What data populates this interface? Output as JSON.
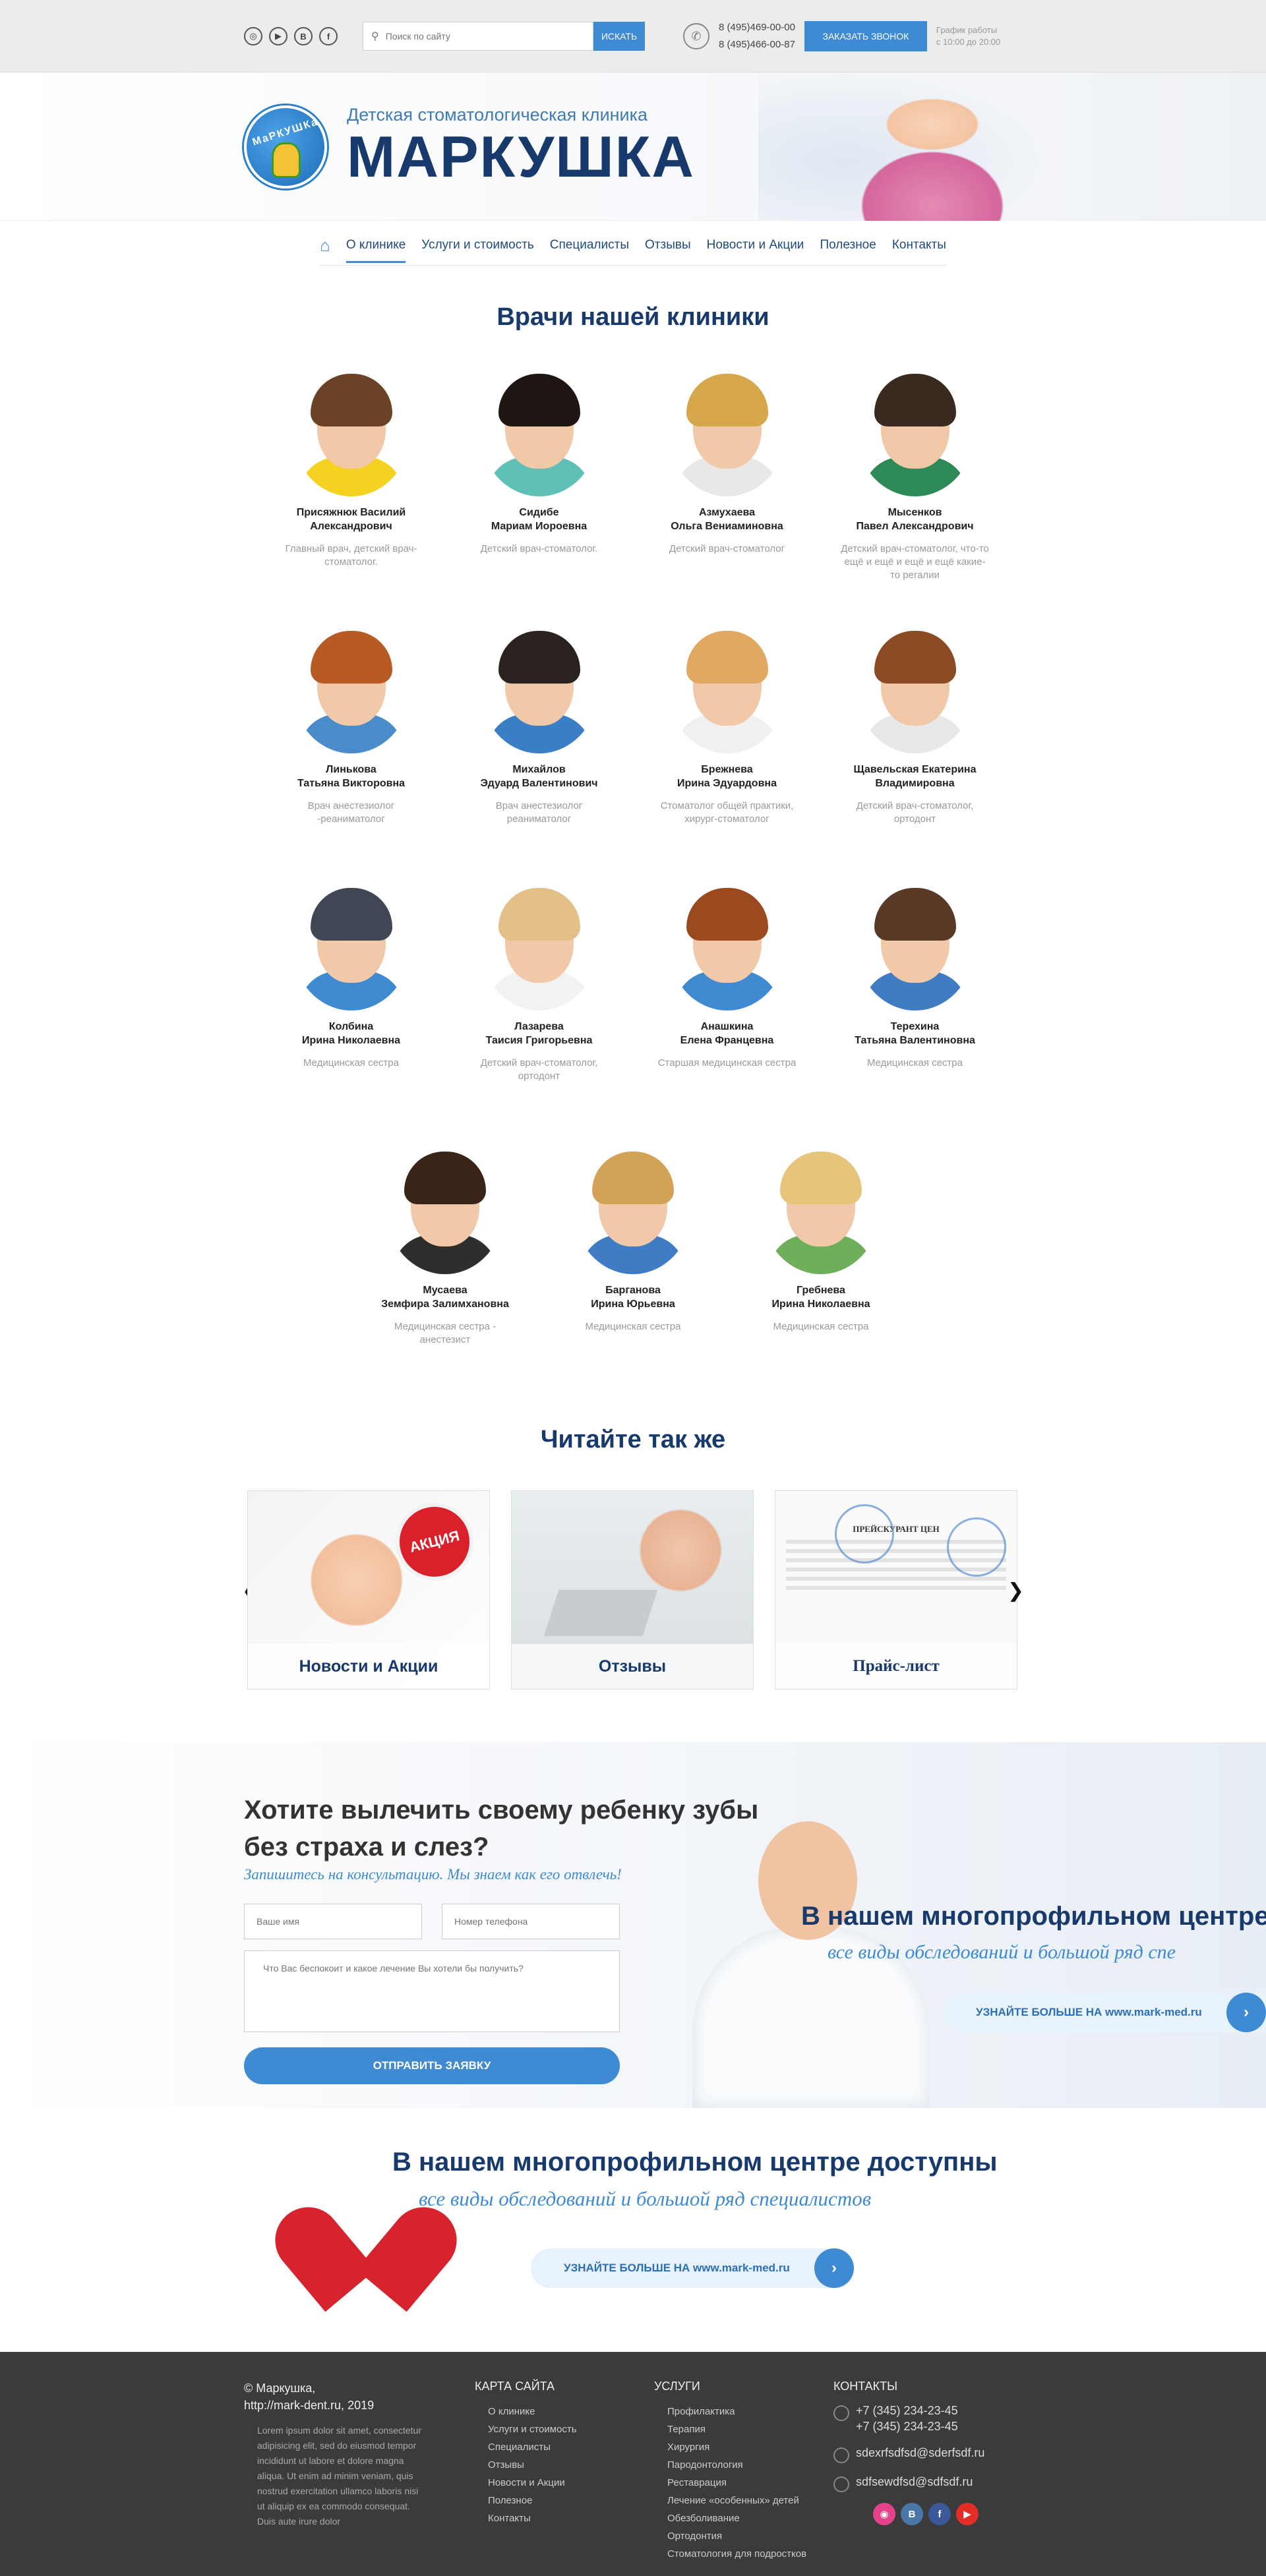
{
  "topbar": {
    "social": [
      {
        "icon": "globe-icon",
        "glyph": "◎"
      },
      {
        "icon": "youtube-icon",
        "glyph": "▶"
      },
      {
        "icon": "vk-icon",
        "glyph": "B"
      },
      {
        "icon": "facebook-icon",
        "glyph": "f"
      }
    ],
    "search_placeholder": "Поиск по сайту",
    "search_button": "ИСКАТЬ",
    "phone1": "8 (495)469-00-00",
    "phone2": "8 (495)466-00-87",
    "call_button": "ЗАКАЗАТЬ ЗВОНОК",
    "hours_line1": "График работы",
    "hours_line2": "с 10:00 до 20:00"
  },
  "header": {
    "logo_letters": "МаРКУШКа",
    "subtitle": "Детская стоматологическая клиника",
    "name": "МАРКУШКА"
  },
  "nav": {
    "items": [
      "О клинике",
      "Услуги и стоимость",
      "Специалисты",
      "Отзывы",
      "Новости и Акции",
      "Полезное",
      "Контакты"
    ],
    "active": "О клинике"
  },
  "doctors": {
    "title": "Врачи нашей клиники",
    "list": [
      {
        "name1": "Присяжнюк Василий",
        "name2": "Александрович",
        "role": "Главный врач, детский врач-стоматолог.",
        "hair": "#6b4225",
        "shirt": "#f4d21f"
      },
      {
        "name1": "Сидибе",
        "name2": "Мариам Иороевна",
        "role": "Детский врач-стоматолог.",
        "hair": "#1d1612",
        "shirt": "#5fc0b8"
      },
      {
        "name1": "Азмухаева",
        "name2": "Ольга Вениаминовна",
        "role": "Детский врач-стоматолог",
        "hair": "#d6a64a",
        "shirt": "#e8e8e8"
      },
      {
        "name1": "Мысенков",
        "name2": "Павел Александрович",
        "role": "Детский врач-стоматолог, что-то ещё и ещё и ещё и ещё какие-то регалии",
        "hair": "#3a2a20",
        "shirt": "#2d8a56"
      },
      {
        "name1": "Линькова",
        "name2": "Татьяна Викторовна",
        "role": "Врач анестезиолог -реаниматолог",
        "hair": "#b85a24",
        "shirt": "#4a8cc9"
      },
      {
        "name1": "Михайлов",
        "name2": "Эдуард Валентинович",
        "role": "Врач анестезиолог реаниматолог",
        "hair": "#2a221e",
        "shirt": "#3a7fc6"
      },
      {
        "name1": "Брежнева",
        "name2": "Ирина Эдуардовна",
        "role": "Стоматолог общей практики, хирург-стоматолог",
        "hair": "#e0a861",
        "shirt": "#f0f0f0"
      },
      {
        "name1": "Щавельская Екатерина",
        "name2": "Владимировна",
        "role": "Детский врач-стоматолог, ортодонт",
        "hair": "#8a4a22",
        "shirt": "#e8e8e8"
      },
      {
        "name1": "Колбина",
        "name2": "Ирина Николаевна",
        "role": "Медицинская сестра",
        "hair": "#404654",
        "shirt": "#3f8ad0"
      },
      {
        "name1": "Лазарева",
        "name2": "Таисия Григорьевна",
        "role": "Детский врач-стоматолог, ортодонт",
        "hair": "#e4c089",
        "shirt": "#f2f2f2"
      },
      {
        "name1": "Анашкина",
        "name2": "Елена Францевна",
        "role": "Старшая медицинская сестра",
        "hair": "#9a4a1e",
        "shirt": "#3f8ad0"
      },
      {
        "name1": "Терехина",
        "name2": "Татьяна Валентиновна",
        "role": "Медицинская сестра",
        "hair": "#5a3a26",
        "shirt": "#3f7cc4"
      }
    ],
    "row3": [
      {
        "name1": "Мусаева",
        "name2": "Земфира Залимхановна",
        "role": "Медицинская сестра - анестезист",
        "hair": "#3a2418",
        "shirt": "#2e2e2e"
      },
      {
        "name1": "Барганова",
        "name2": "Ирина Юрьевна",
        "role": "Медицинская сестра",
        "hair": "#d2a357",
        "shirt": "#3f7cc4"
      },
      {
        "name1": "Гребнева",
        "name2": "Ирина Николаевна",
        "role": "Медицинская сестра",
        "hair": "#e6c47a",
        "shirt": "#6fae5a"
      }
    ]
  },
  "read_also": {
    "title": "Читайте так же",
    "cards": [
      "Новости и Акции",
      "Отзывы",
      "Прайс-лист"
    ],
    "badge": "АКЦИЯ",
    "price_doc_title": "ПРЕЙСКУРАНТ ЦЕН"
  },
  "consult": {
    "title_line1": "Хотите вылечить своему ребенку зубы",
    "title_line2": "без страха и слез?",
    "subtitle": "Запишитесь на консультацию. Мы знаем как его отвлечь!",
    "name_placeholder": "Ваше имя",
    "phone_placeholder": "Номер телефона",
    "message_placeholder": "Что Вас беспокоит и какое лечение Вы хотели бы получить?",
    "submit": "ОТПРАВИТЬ ЗАЯВКУ",
    "promo_title": "В нашем многопрофильном центре",
    "promo_sub": "все виды обследований и большой ряд спе",
    "promo_button": "УЗНАЙТЕ БОЛЬШЕ НА www.mark-med.ru"
  },
  "center_block": {
    "title": "В нашем многопрофильном центре доступны",
    "subtitle": "все виды обследований и большой ряд специалистов",
    "button": "УЗНАЙТЕ БОЛЬШЕ НА www.mark-med.ru"
  },
  "footer": {
    "copy_line1": "© Маркушка,",
    "copy_line2": "http://mark-dent.ru, 2019",
    "lorem": "Lorem ipsum dolor sit amet, consectetur adipisicing elit, sed do eiusmod tempor incididunt ut labore et dolore magna aliqua. Ut enim ad minim veniam, quis nostrud exercitation ullamco laboris nisi ut aliquip ex ea commodo consequat. Duis aute irure dolor",
    "sitemap_title": "КАРТА САЙТА",
    "sitemap": [
      "О клинике",
      "Услуги и стоимость",
      "Специалисты",
      "Отзывы",
      "Новости и Акции",
      "Полезное",
      "Контакты"
    ],
    "services_title": "УСЛУГИ",
    "services": [
      "Профилактика",
      "Терапия",
      "Хирургия",
      "Пародонтология",
      "Реставрация",
      "Лечение «особенных» детей",
      "Обезболивание",
      "Ортодонтия",
      "Стоматология для подростков"
    ],
    "contacts_title": "КОНТАКТЫ",
    "phone1": "+7 (345) 234-23-45",
    "phone2": "+7 (345) 234-23-45",
    "email1": "sdexrfsdfsd@sderfsdf.ru",
    "email2": "sdfsewdfsd@sdfsdf.ru",
    "social": [
      {
        "icon": "dribbble-icon",
        "glyph": "◉",
        "color": "#e4438b"
      },
      {
        "icon": "vk-icon",
        "glyph": "B",
        "color": "#4a76a8"
      },
      {
        "icon": "facebook-icon",
        "glyph": "f",
        "color": "#3b5998"
      },
      {
        "icon": "youtube-icon",
        "glyph": "▶",
        "color": "#e52d27"
      }
    ]
  }
}
